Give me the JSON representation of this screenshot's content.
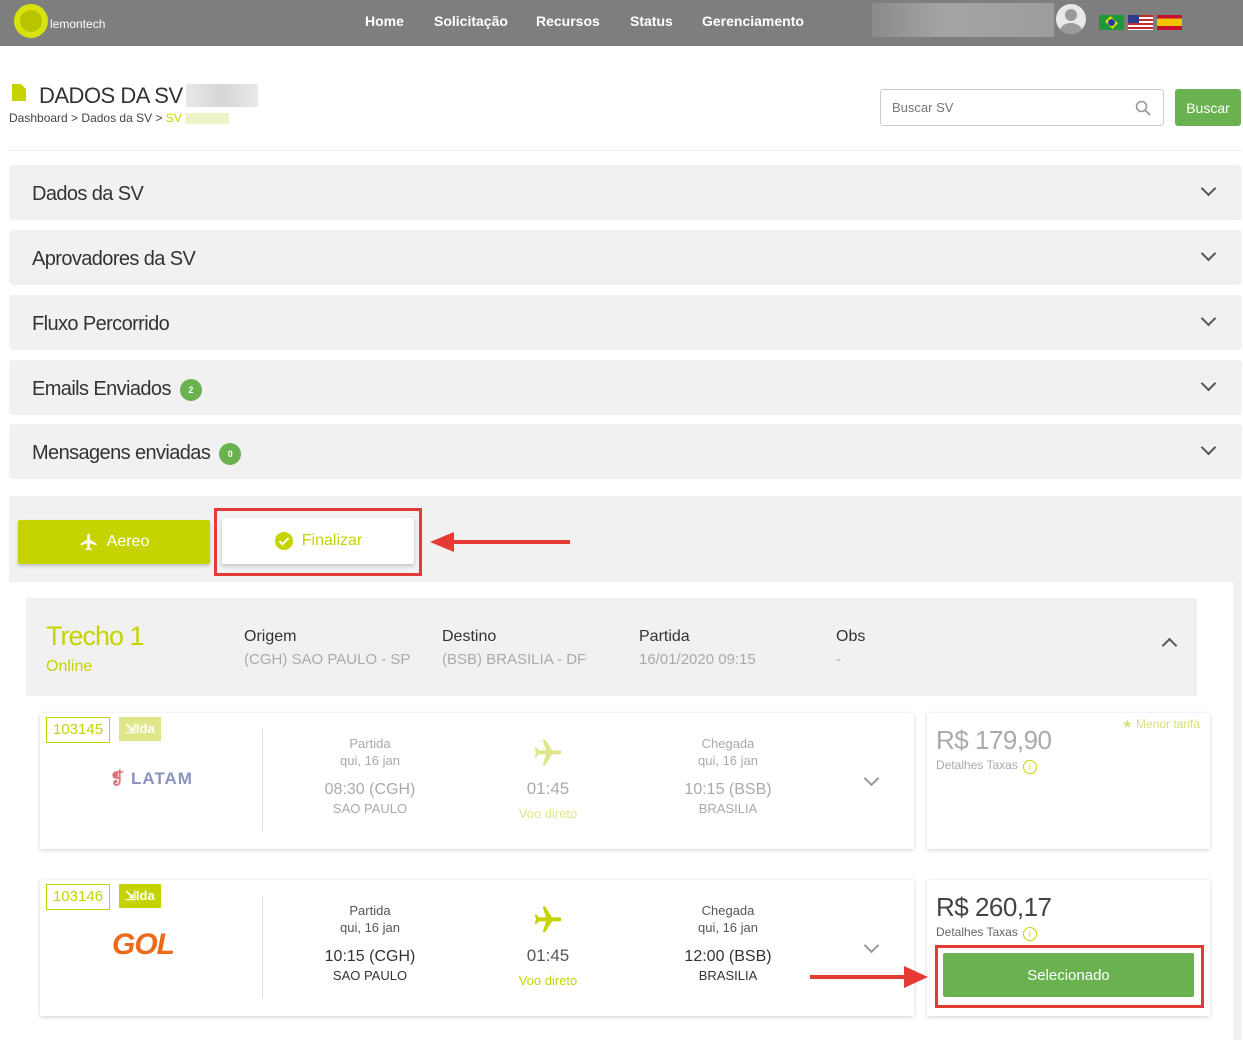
{
  "nav": {
    "logo_text": "lemontech",
    "items": [
      "Home",
      "Solicitação",
      "Recursos",
      "Status",
      "Gerenciamento"
    ]
  },
  "header": {
    "title": "DADOS DA SV",
    "breadcrumb": [
      "Dashboard",
      "Dados da SV",
      "SV"
    ],
    "search_placeholder": "Buscar SV",
    "search_button": "Buscar"
  },
  "accordions": [
    {
      "title": "Dados da SV"
    },
    {
      "title": "Aprovadores da SV"
    },
    {
      "title": "Fluxo Percorrido"
    },
    {
      "title": "Emails Enviados",
      "badge": "2"
    },
    {
      "title": "Mensagens enviadas",
      "badge": "0"
    }
  ],
  "actions": {
    "aereo": "Aereo",
    "finalizar": "Finalizar"
  },
  "trecho": {
    "title": "Trecho 1",
    "subtitle": "Online",
    "columns": [
      {
        "label": "Origem",
        "value": "(CGH) SAO PAULO - SP"
      },
      {
        "label": "Destino",
        "value": "(BSB) BRASILIA - DF"
      },
      {
        "label": "Partida",
        "value": "16/01/2020 09:15"
      },
      {
        "label": "Obs",
        "value": "-"
      }
    ]
  },
  "flights": [
    {
      "code": "103145",
      "type": "Ida",
      "airline": "LATAM",
      "dep_label": "Partida",
      "dep_date": "qui, 16 jan",
      "dep_time": "08:30 (CGH)",
      "dep_city": "SAO PAULO",
      "duration": "01:45",
      "direct": "Voo direto",
      "arr_label": "Chegada",
      "arr_date": "qui, 16 jan",
      "arr_time": "10:15 (BSB)",
      "arr_city": "BRASILIA",
      "price": "R$ 179,90",
      "taxas": "Detalhes Taxas",
      "tag": "Menor tarifa"
    },
    {
      "code": "103146",
      "type": "Ida",
      "airline": "GOL",
      "dep_label": "Partida",
      "dep_date": "qui, 16 jan",
      "dep_time": "10:15 (CGH)",
      "dep_city": "SAO PAULO",
      "duration": "01:45",
      "direct": "Voo direto",
      "arr_label": "Chegada",
      "arr_date": "qui, 16 jan",
      "arr_time": "12:00 (BSB)",
      "arr_city": "BRASILIA",
      "price": "R$ 260,17",
      "taxas": "Detalhes Taxas",
      "selected_label": "Selecionado"
    }
  ],
  "colors": {
    "accent": "#c5d400",
    "success": "#6ab150",
    "highlight": "#e53935",
    "topbar": "#7e7e7e"
  }
}
